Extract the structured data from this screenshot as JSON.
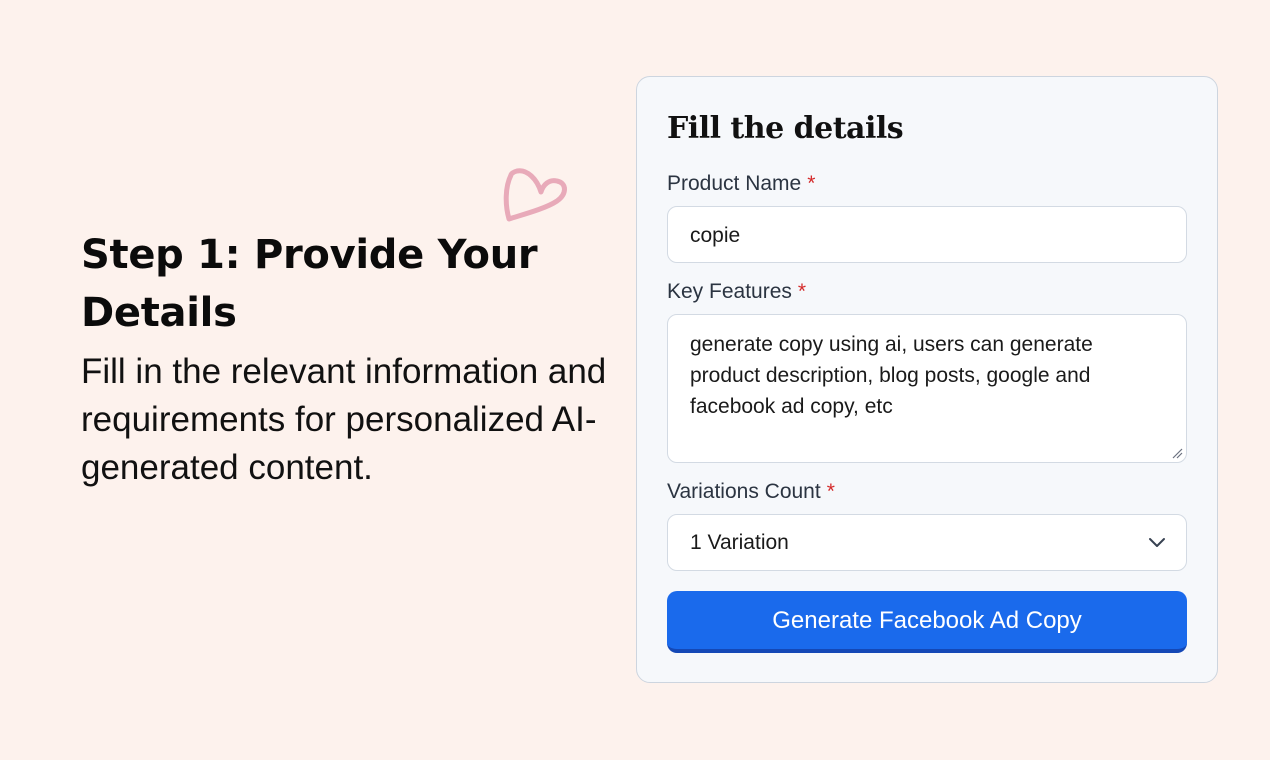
{
  "intro": {
    "title": "Step 1: Provide Your Details",
    "description": "Fill in the relevant information and requirements for personalized AI-generated content."
  },
  "form": {
    "title": "Fill the details",
    "required_marker": "*",
    "product_name": {
      "label": "Product Name",
      "value": "copie"
    },
    "key_features": {
      "label": "Key Features",
      "value": "generate copy using ai, users can generate product description, blog posts, google and facebook ad copy, etc"
    },
    "variations_count": {
      "label": "Variations Count",
      "selected": "1 Variation"
    },
    "submit_label": "Generate Facebook Ad Copy"
  },
  "colors": {
    "page_background": "#fdf2ed",
    "accent_blue": "#1a6aec",
    "required_red": "#d42a2a",
    "heart_pink": "#e8aab9"
  },
  "icons": {
    "decoration": "heart-outline-icon",
    "select_arrow": "chevron-down-icon",
    "resize": "resize-handle-icon"
  }
}
